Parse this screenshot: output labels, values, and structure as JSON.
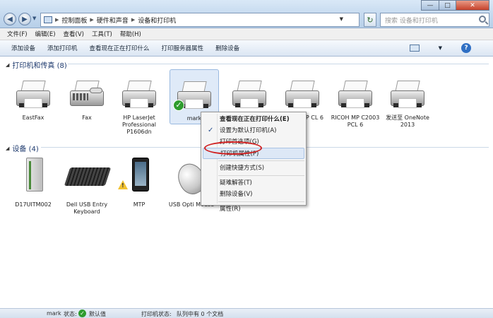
{
  "address_bar": {
    "crumbs": [
      "控制面板",
      "硬件和声音",
      "设备和打印机"
    ],
    "search_placeholder": "搜索 设备和打印机"
  },
  "window_controls": {
    "minimize": "—",
    "maximize": "□",
    "close": "✕"
  },
  "menubar": [
    "文件(F)",
    "编辑(E)",
    "查看(V)",
    "工具(T)",
    "帮助(H)"
  ],
  "toolbar": [
    "添加设备",
    "添加打印机",
    "查看现在正在打印什么",
    "打印服务器属性",
    "删除设备"
  ],
  "groups": {
    "printers": {
      "title": "打印机和传真 (8)"
    },
    "devices": {
      "title": "设备 (4)"
    }
  },
  "printers": [
    {
      "label": "EastFax",
      "icon": "fax-printer-icon"
    },
    {
      "label": "Fax",
      "icon": "fax-machine-icon"
    },
    {
      "label": "HP LaserJet Professional P1606dn",
      "icon": "printer-icon"
    },
    {
      "label": "mark",
      "icon": "printer-icon",
      "default": true
    },
    {
      "label": "",
      "icon": "printer-icon"
    },
    {
      "label": "MP CL 6",
      "icon": "printer-icon"
    },
    {
      "label": "RICOH MP C2003 PCL 6",
      "icon": "printer-icon"
    },
    {
      "label": "发送至 OneNote 2013",
      "icon": "printer-icon"
    }
  ],
  "devices": [
    {
      "label": "D17UITM002",
      "icon": "computer-tower-icon"
    },
    {
      "label": "Dell USB Entry Keyboard",
      "icon": "keyboard-icon"
    },
    {
      "label": "MTP",
      "icon": "phone-icon",
      "warning": true
    },
    {
      "label": "USB Opti Mouse",
      "icon": "mouse-icon"
    }
  ],
  "context_menu": {
    "items": [
      {
        "label": "查看现在正在打印什么(E)",
        "bold": true
      },
      {
        "label": "设置为默认打印机(A)",
        "checked": true
      },
      {
        "label": "打印首选项(G)"
      },
      {
        "label": "打印机属性(P)",
        "highlighted": true
      },
      {
        "sep": true
      },
      {
        "label": "创建快捷方式(S)"
      },
      {
        "sep": true
      },
      {
        "label": "疑难解答(T)"
      },
      {
        "label": "删除设备(V)"
      },
      {
        "sep": true
      },
      {
        "label": "属性(R)"
      }
    ]
  },
  "status_bar": {
    "name": "mark",
    "state_label": "状态:",
    "state_value": "默认值",
    "printer_state_label": "打印机状态:",
    "printer_state_value": "队列中有 0 个文档"
  }
}
